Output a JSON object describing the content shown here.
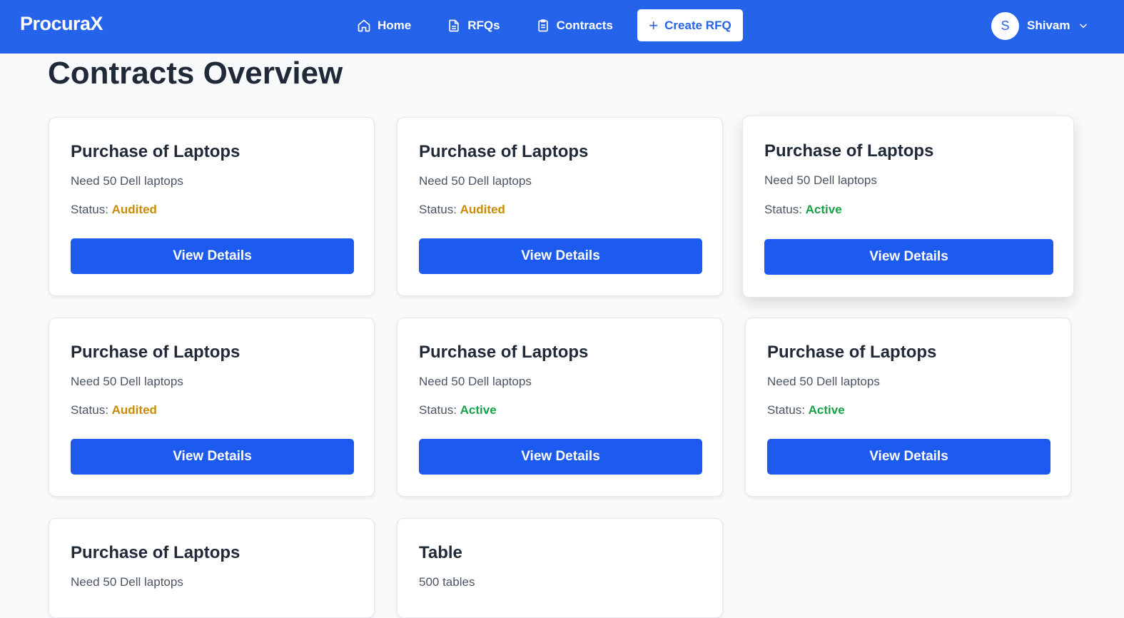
{
  "nav": {
    "brand": "ProcuraX",
    "links": [
      {
        "label": "Home",
        "icon": "home-icon"
      },
      {
        "label": "RFQs",
        "icon": "document-icon"
      },
      {
        "label": "Contracts",
        "icon": "clipboard-icon"
      }
    ],
    "create_label": "Create RFQ",
    "user": {
      "initial": "S",
      "name": "Shivam"
    }
  },
  "page": {
    "title": "Contracts Overview"
  },
  "labels": {
    "status_prefix": "Status: ",
    "view_details": "View Details"
  },
  "colors": {
    "primary": "#2563eb",
    "audited": "#ca8a04",
    "active": "#16a34a"
  },
  "contracts": [
    {
      "title": "Purchase of Laptops",
      "description": "Need 50 Dell laptops",
      "status": "Audited"
    },
    {
      "title": "Purchase of Laptops",
      "description": "Need 50 Dell laptops",
      "status": "Audited"
    },
    {
      "title": "Purchase of Laptops",
      "description": "Need 50 Dell laptops",
      "status": "Active"
    },
    {
      "title": "Purchase of Laptops",
      "description": "Need 50 Dell laptops",
      "status": "Audited"
    },
    {
      "title": "Purchase of Laptops",
      "description": "Need 50 Dell laptops",
      "status": "Active"
    },
    {
      "title": "Purchase of Laptops",
      "description": "Need 50 Dell laptops",
      "status": "Active"
    },
    {
      "title": "Purchase of Laptops",
      "description": "Need 50 Dell laptops"
    },
    {
      "title": "Table",
      "description": "500 tables"
    }
  ]
}
